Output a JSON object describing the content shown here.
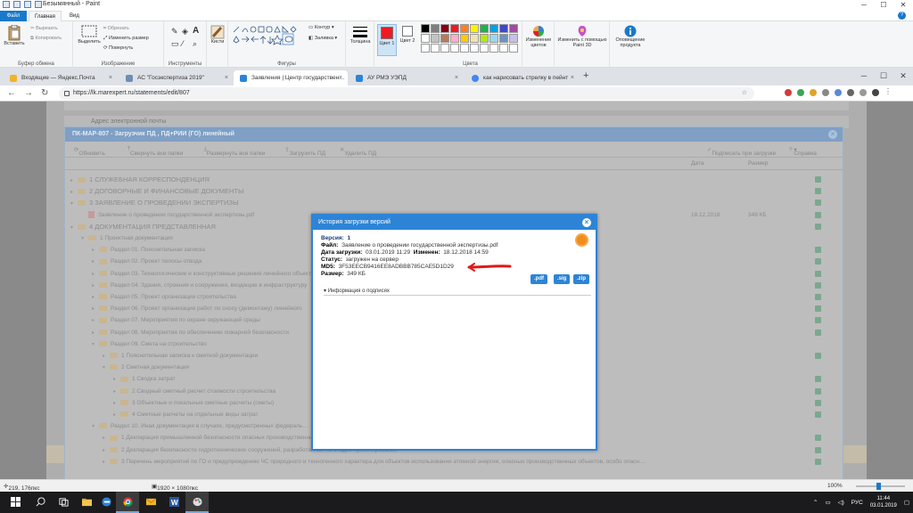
{
  "paint": {
    "title": "Безымянный - Paint",
    "tabs": [
      "Файл",
      "Главная",
      "Вид"
    ],
    "clipboard": {
      "paste": "Вставить",
      "cut": "Вырезать",
      "copy": "Копировать",
      "group": "Буфер обмена"
    },
    "image": {
      "select": "Выделить",
      "crop": "Обрезать",
      "resize": "Изменить размер",
      "rotate": "Повернуть",
      "group": "Изображение"
    },
    "tools": {
      "group": "Инструменты"
    },
    "brushes": "Кисти",
    "shapes": {
      "outline": "Контур",
      "fill": "Заливка",
      "group": "Фигуры"
    },
    "thickness": "Толщина",
    "color1": "Цвет 1",
    "color2": "Цвет 2",
    "colors_group": "Цвета",
    "edit_colors": "Изменение цветов",
    "paint3d": "Изменить с помощью Paint 3D",
    "product_alert": "Оповещение продукта",
    "status": {
      "cursor": "219, 176пкс",
      "size": "1920 × 1080пкс",
      "zoom": "100%"
    }
  },
  "palette": [
    "#000000",
    "#7f7f7f",
    "#880015",
    "#ed1c24",
    "#ff7f27",
    "#fff200",
    "#22b14c",
    "#00a2e8",
    "#3f48cc",
    "#a349a4",
    "#ffffff",
    "#c3c3c3",
    "#b97a57",
    "#ffaec9",
    "#ffc90e",
    "#efe4b0",
    "#b5e61d",
    "#99d9ea",
    "#7092be",
    "#c8bfe7",
    "#ffffff",
    "#ffffff",
    "#ffffff",
    "#ffffff",
    "#ffffff",
    "#ffffff",
    "#ffffff",
    "#ffffff",
    "#ffffff",
    "#ffffff"
  ],
  "browser": {
    "tabs": [
      {
        "title": "Входящие — Яндекс.Почта",
        "color": "#f0b429"
      },
      {
        "title": "АС \"Госэкспертиза 2019\"",
        "color": "#6d8fb5"
      },
      {
        "title": "Заявления | Центр государствен…",
        "color": "#2d84d6"
      },
      {
        "title": "АУ РМЭ УЭПД",
        "color": "#2d84d6"
      },
      {
        "title": "как нарисовать стрелку в пейнт",
        "color": "#4285f4"
      }
    ],
    "url": "https://lk.marexpert.ru/statements/edit/807"
  },
  "page": {
    "bg_field": "Адрес электронной почты",
    "dialog_title": "ПК-МАР-807 - Загрузчик ПД , ПД+РИИ (ГО) линейный",
    "toolbar": {
      "refresh": "Обновить",
      "collapse": "Свернуть все папки",
      "expand": "Развернуть все папки",
      "upload": "Загрузить ПД",
      "delete": "Удалить ПД",
      "sign": "Подписать при загрузке",
      "help": "Справка"
    },
    "columns": {
      "date": "Дата",
      "size": "Размер"
    },
    "tree": [
      {
        "text": "1 СЛУЖЕБНАЯ КОРРЕСПОНДЕНЦИЯ",
        "level": 0,
        "type": "folder"
      },
      {
        "text": "2 ДОГОВОРНЫЕ И ФИНАНСОВЫЕ ДОКУМЕНТЫ",
        "level": 0,
        "type": "folder"
      },
      {
        "text": "3 ЗАЯВЛЕНИЕ О ПРОВЕДЕНИИ ЭКСПЕРТИЗЫ",
        "level": 0,
        "type": "folder-open"
      },
      {
        "text": "Заявление о проведении государственной экспертизы.pdf",
        "level": 1,
        "type": "pdf",
        "date": "18.12.2018",
        "size": "349 КБ"
      },
      {
        "text": "4 ДОКУМЕНТАЦИЯ ПРЕДСТАВЛЕННАЯ",
        "level": 0,
        "type": "folder-open"
      },
      {
        "text": "1 Проектная документация",
        "level": 1,
        "type": "folder-open"
      },
      {
        "text": "Раздел 01. Пояснительная записка",
        "level": 2,
        "type": "folder"
      },
      {
        "text": "Раздел 02. Проект полосы отвода",
        "level": 2,
        "type": "folder"
      },
      {
        "text": "Раздел 03. Технологические и конструктивные решения линейного объекта",
        "level": 2,
        "type": "folder"
      },
      {
        "text": "Раздел 04. Здания, строения и сооружения, входящие в инфраструктуру",
        "level": 2,
        "type": "folder"
      },
      {
        "text": "Раздел 05. Проект организации строительства",
        "level": 2,
        "type": "folder"
      },
      {
        "text": "Раздел 06. Проект организации работ по сносу (демонтажу) линейного",
        "level": 2,
        "type": "folder"
      },
      {
        "text": "Раздел 07. Мероприятия по охране окружающей среды",
        "level": 2,
        "type": "folder"
      },
      {
        "text": "Раздел 08. Мероприятия по обеспечению пожарной безопасности",
        "level": 2,
        "type": "folder"
      },
      {
        "text": "Раздел 09. Смета на строительство",
        "level": 2,
        "type": "folder-open"
      },
      {
        "text": "1 Пояснительная записка к сметной документации",
        "level": 3,
        "type": "folder"
      },
      {
        "text": "2 Сметная документация",
        "level": 3,
        "type": "folder-open"
      },
      {
        "text": "1 Сводка затрат",
        "level": 4,
        "type": "folder"
      },
      {
        "text": "2 Сводный сметный расчет стоимости строительства",
        "level": 4,
        "type": "folder"
      },
      {
        "text": "3 Объектные и локальные сметные расчеты (сметы)",
        "level": 4,
        "type": "folder"
      },
      {
        "text": "4 Сметные расчеты на отдельные виды затрат",
        "level": 4,
        "type": "folder"
      },
      {
        "text": "Раздел 10. Иная документация в случаях, предусмотренных федераль…",
        "level": 2,
        "type": "folder-open"
      },
      {
        "text": "1 Декларация промышленной безопасности опасных производственных объектов",
        "level": 3,
        "type": "folder"
      },
      {
        "text": "2 Декларация безопасности гидротехнических сооружений, разработанная на стадии проектирования",
        "level": 3,
        "type": "folder"
      },
      {
        "text": "3 Перечень мероприятий по ГО и предупреждению ЧС природного и техногенного характера для объектов использования атомной энергии, опасных производственных объектов, особо опасн…",
        "level": 3,
        "type": "folder"
      }
    ]
  },
  "history": {
    "title": "История загрузки версий",
    "version_label": "Версия:",
    "version": "1",
    "file_label": "Файл:",
    "file": "Заявление о проведении государственной экспертизы.pdf",
    "upload_label": "Дата загрузки:",
    "upload_date": "03.01.2019 11:29",
    "modified_label": "Изменен:",
    "modified": "18.12.2018 14:59",
    "status_label": "Статус:",
    "status": "загружен на сервер",
    "md5_label": "MD5:",
    "md5": "3F53EECB9416EE8ADBBB785CAE5D1D29",
    "size_label": "Размер:",
    "size": "349 КБ",
    "buttons": [
      ".pdf",
      ".sig",
      ".zip"
    ],
    "signature_info": "Информация о подписях"
  },
  "taskbar": {
    "lang": "РУС",
    "time": "11:44",
    "date": "03.01.2019"
  }
}
